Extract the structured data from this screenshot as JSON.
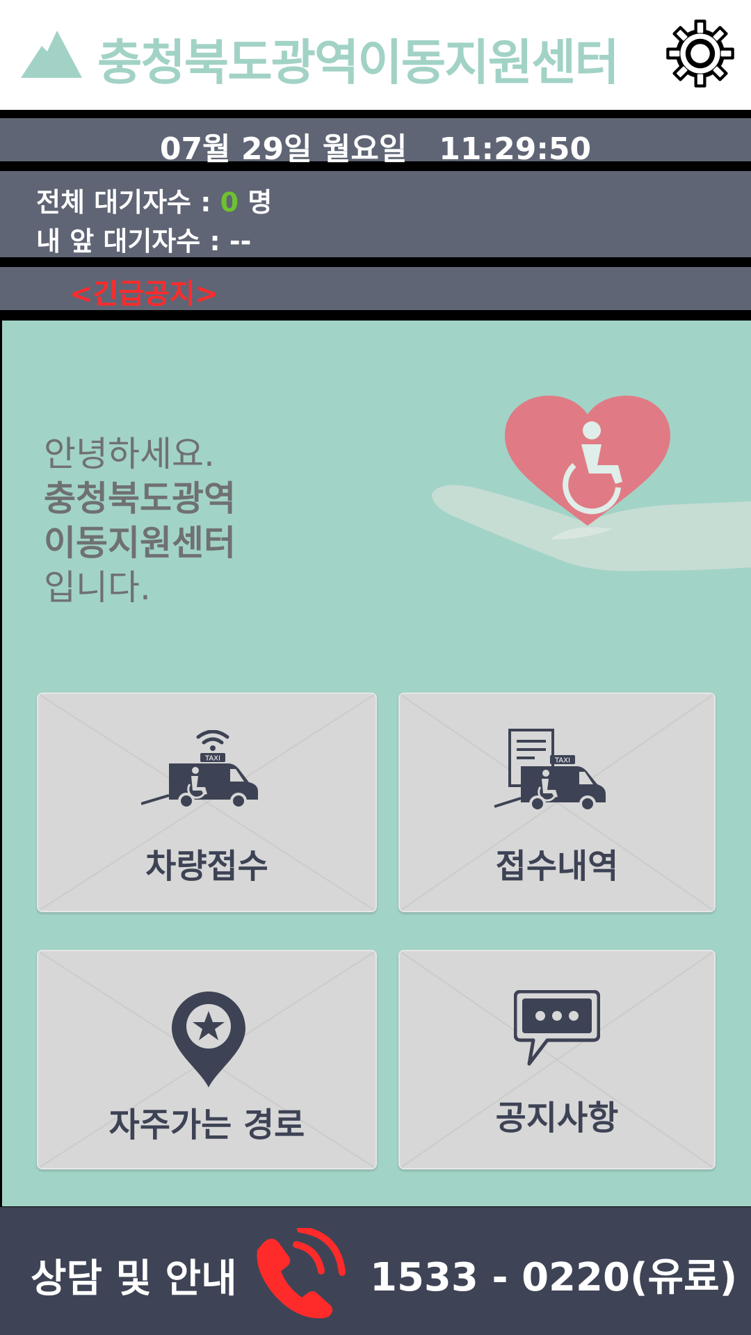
{
  "header": {
    "title": "충청북도광역이동지원센터",
    "logo_icon": "mountain-icon",
    "settings_icon": "gear-icon"
  },
  "status": {
    "datetime": "07월 29일 월요일   11:29:50",
    "total_waiting_label": "전체 대기자수 : ",
    "total_waiting_count": "0",
    "total_waiting_unit": " 명",
    "ahead_waiting_label": "내 앞 대기자수 : --"
  },
  "notice": {
    "text": "<긴급공지>"
  },
  "greeting": {
    "line1": "안녕하세요.",
    "line2": "충청북도광역",
    "line3": "이동지원센터",
    "line4": "입니다."
  },
  "menu": {
    "items": [
      {
        "label": "차량접수",
        "icon": "taxi-request-icon"
      },
      {
        "label": "접수내역",
        "icon": "request-history-icon"
      },
      {
        "label": "자주가는 경로",
        "icon": "favorite-location-icon"
      },
      {
        "label": "공지사항",
        "icon": "chat-bubble-icon"
      }
    ]
  },
  "footer": {
    "label": "상담 및 안내",
    "phone": "1533 - 0220(유료)",
    "phone_icon": "phone-icon"
  },
  "colors": {
    "accent": "#a2d2c6",
    "bar": "#5f6575",
    "footer": "#3e4455",
    "alert": "#ff2b2b",
    "count": "#6fc22f",
    "heart": "#e07b85"
  }
}
